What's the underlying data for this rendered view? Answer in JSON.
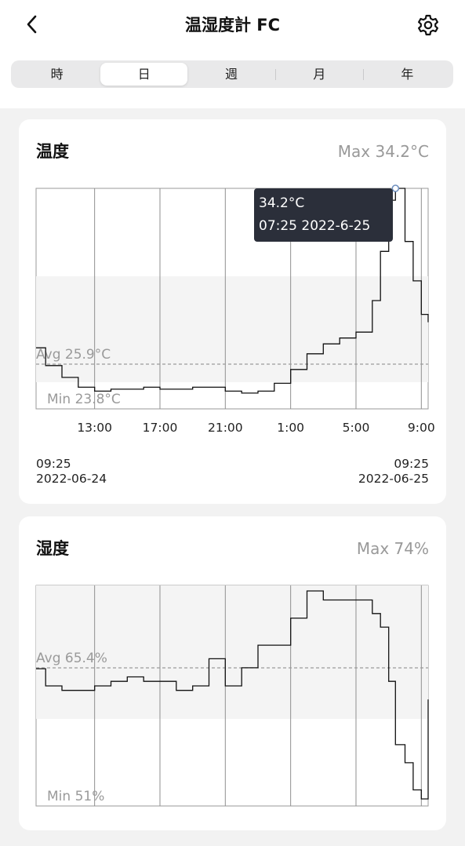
{
  "header": {
    "title": "温湿度計 FC",
    "back_icon": "chevron-left-icon",
    "settings_icon": "gear-icon"
  },
  "tabs": [
    {
      "label": "時",
      "active": false
    },
    {
      "label": "日",
      "active": true
    },
    {
      "label": "週",
      "active": false
    },
    {
      "label": "月",
      "active": false
    },
    {
      "label": "年",
      "active": false
    }
  ],
  "temperature": {
    "title": "温度",
    "max_label": "Max 34.2°C",
    "avg_label": "Avg 25.9°C",
    "min_label": "Min 23.8°C",
    "tooltip_value": "34.2°C",
    "tooltip_time": "07:25 2022-6-25",
    "start_time": "09:25",
    "start_date": "2022-06-24",
    "end_time": "09:25",
    "end_date": "2022-06-25"
  },
  "humidity": {
    "title": "湿度",
    "max_label": "Max 74%",
    "avg_label": "Avg 65.4%",
    "min_label": "Min 51%"
  },
  "chart_data": [
    {
      "type": "line",
      "title": "温度",
      "unit": "°C",
      "x_tick_labels": [
        "13:00",
        "17:00",
        "21:00",
        "1:00",
        "5:00",
        "9:00"
      ],
      "x": [
        "09:25",
        "10:00",
        "11:00",
        "12:00",
        "13:00",
        "14:00",
        "15:00",
        "16:00",
        "17:00",
        "18:00",
        "19:00",
        "20:00",
        "21:00",
        "22:00",
        "23:00",
        "0:00",
        "1:00",
        "2:00",
        "3:00",
        "4:00",
        "5:00",
        "6:00",
        "6:30",
        "7:00",
        "7:25",
        "8:00",
        "8:30",
        "9:00",
        "9:25"
      ],
      "y": [
        26.1,
        25.2,
        24.6,
        24.1,
        23.9,
        24.0,
        24.0,
        24.1,
        24.0,
        24.0,
        24.1,
        24.1,
        23.9,
        23.8,
        23.9,
        24.3,
        25.0,
        25.8,
        26.3,
        26.6,
        26.9,
        28.5,
        31.0,
        33.6,
        34.2,
        31.5,
        29.5,
        27.8,
        27.4
      ],
      "ylim": [
        23.0,
        34.2
      ],
      "highlighted_point": {
        "x": "07:25",
        "y": 34.2
      },
      "summary": {
        "max": 34.2,
        "avg": 25.9,
        "min": 23.8
      }
    },
    {
      "type": "line",
      "title": "湿度",
      "unit": "%",
      "x": [
        "09:25",
        "10:00",
        "11:00",
        "12:00",
        "13:00",
        "14:00",
        "15:00",
        "16:00",
        "17:00",
        "18:00",
        "19:00",
        "20:00",
        "21:00",
        "22:00",
        "23:00",
        "0:00",
        "1:00",
        "2:00",
        "3:00",
        "4:00",
        "5:00",
        "6:00",
        "6:30",
        "7:00",
        "7:25",
        "8:00",
        "8:30",
        "9:00",
        "9:25"
      ],
      "y": [
        65.4,
        63.5,
        63.0,
        63.0,
        63.5,
        64.0,
        64.5,
        64.0,
        64.0,
        63.0,
        63.5,
        66.5,
        63.5,
        65.5,
        68.0,
        68.0,
        71.0,
        74.0,
        73.0,
        73.0,
        73.0,
        71.5,
        70.0,
        64.0,
        57.0,
        55.0,
        52.0,
        51.0,
        62.0
      ],
      "ylim": [
        51,
        74
      ],
      "summary": {
        "max": 74,
        "avg": 65.4,
        "min": 51
      }
    }
  ]
}
